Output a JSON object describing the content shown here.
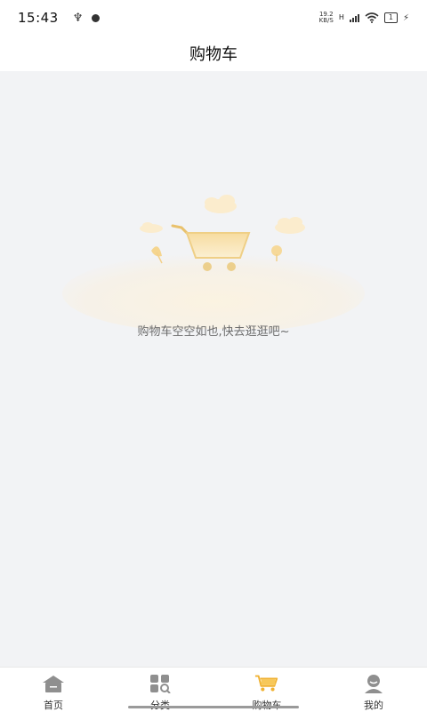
{
  "status_bar": {
    "time": "15:43",
    "net_speed_value": "19.2",
    "net_speed_unit": "KB/S",
    "network_type": "H",
    "battery_level": "1",
    "icons": [
      "usb-icon",
      "dot-icon",
      "signal-icon",
      "wifi-icon",
      "battery-icon",
      "charging-icon"
    ]
  },
  "header": {
    "title": "购物车"
  },
  "empty_state": {
    "message": "购物车空空如也,快去逛逛吧~",
    "illustration": "empty-cart-icon"
  },
  "tabbar": {
    "tabs": [
      {
        "label": "首页",
        "icon": "home-icon",
        "active": false
      },
      {
        "label": "分类",
        "icon": "category-icon",
        "active": false
      },
      {
        "label": "购物车",
        "icon": "cart-icon",
        "active": true
      },
      {
        "label": "我的",
        "icon": "profile-icon",
        "active": false
      }
    ]
  },
  "colors": {
    "accent": "#f0b233",
    "background": "#f2f3f5",
    "tab_icon_gray": "#8f8f8f"
  }
}
